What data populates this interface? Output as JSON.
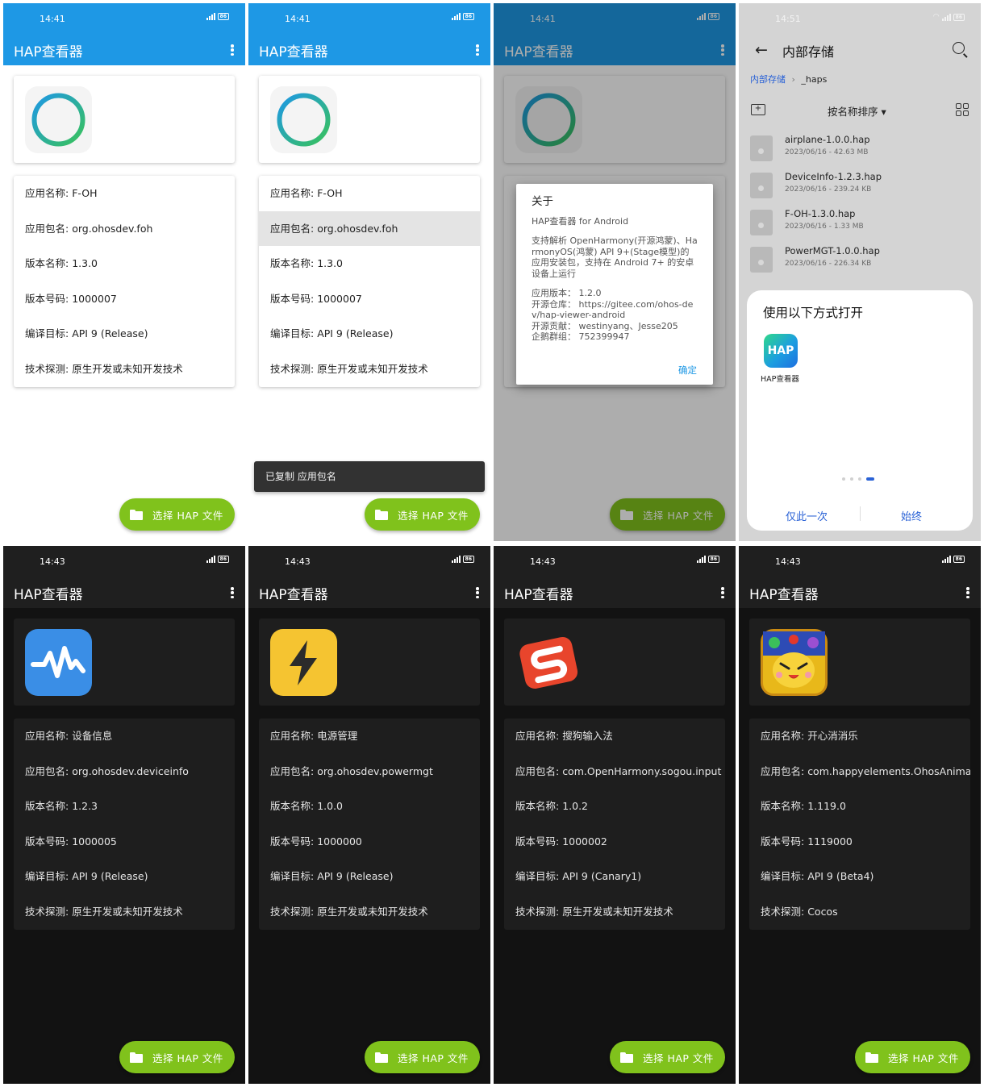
{
  "app_title": "HAP查看器",
  "fab_label": "选择 HAP 文件",
  "labels": {
    "name": "应用名称: ",
    "package": "应用包名: ",
    "version_name": "版本名称: ",
    "version_code": "版本号码: ",
    "target": "编译目标: ",
    "tech": "技术探测: "
  },
  "battery": "86",
  "screens": [
    {
      "time": "14:41",
      "name": "F-OH",
      "package": "org.ohosdev.foh",
      "version_name": "1.3.0",
      "version_code": "1000007",
      "target": "API 9 (Release)",
      "tech": "原生开发或未知开发技术"
    },
    {
      "time": "14:41",
      "name": "F-OH",
      "package": "org.ohosdev.foh",
      "version_name": "1.3.0",
      "version_code": "1000007",
      "target": "API 9 (Release)",
      "tech": "原生开发或未知开发技术",
      "toast": "已复制 应用包名"
    },
    {
      "time": "14:41"
    },
    {
      "time": "14:51"
    },
    {
      "time": "14:43",
      "name": "设备信息",
      "package": "org.ohosdev.deviceinfo",
      "version_name": "1.2.3",
      "version_code": "1000005",
      "target": "API 9 (Release)",
      "tech": "原生开发或未知开发技术"
    },
    {
      "time": "14:43",
      "name": "电源管理",
      "package": "org.ohosdev.powermgt",
      "version_name": "1.0.0",
      "version_code": "1000000",
      "target": "API 9 (Release)",
      "tech": "原生开发或未知开发技术"
    },
    {
      "time": "14:43",
      "name": "搜狗输入法",
      "package": "com.OpenHarmony.sogou.input",
      "version_name": "1.0.2",
      "version_code": "1000002",
      "target": "API 9 (Canary1)",
      "tech": "原生开发或未知开发技术"
    },
    {
      "time": "14:43",
      "name": "开心消消乐",
      "package": "com.happyelements.OhosAnimal",
      "version_name": "1.119.0",
      "version_code": "1119000",
      "target": "API 9 (Beta4)",
      "tech": "Cocos"
    }
  ],
  "about_dialog": {
    "title": "关于",
    "subtitle": "HAP查看器 for Android",
    "description": "支持解析 OpenHarmony(开源鸿蒙)、HarmonyOS(鸿蒙) API 9+(Stage模型)的应用安装包，支持在 Android 7+ 的安卓设备上运行",
    "version": "应用版本： 1.2.0",
    "repo": "开源仓库： https://gitee.com/ohos-dev/hap-viewer-android",
    "contributors": "开源贡献： westinyang、Jesse205",
    "qq_group": "企鹅群组： 752399947",
    "ok": "确定"
  },
  "file_picker": {
    "title": "内部存储",
    "crumb_root": "内部存储",
    "crumb_sub": "_haps",
    "sort_label": "按名称排序 ▾",
    "files": [
      {
        "name": "airplane-1.0.0.hap",
        "meta": "2023/06/16 - 42.63 MB"
      },
      {
        "name": "DeviceInfo-1.2.3.hap",
        "meta": "2023/06/16 - 239.24 KB"
      },
      {
        "name": "F-OH-1.3.0.hap",
        "meta": "2023/06/16 - 1.33 MB"
      },
      {
        "name": "PowerMGT-1.0.0.hap",
        "meta": "2023/06/16 - 226.34 KB"
      }
    ],
    "sheet_title": "使用以下方式打开",
    "sheet_app": "HAP查看器",
    "sheet_app_icon_text": "HAP",
    "once": "仅此一次",
    "always": "始终"
  },
  "colors": {
    "primary": "#1e98e5",
    "fab": "#80c21c",
    "dark_bg": "#121212",
    "dark_card": "#1e1e1e"
  }
}
